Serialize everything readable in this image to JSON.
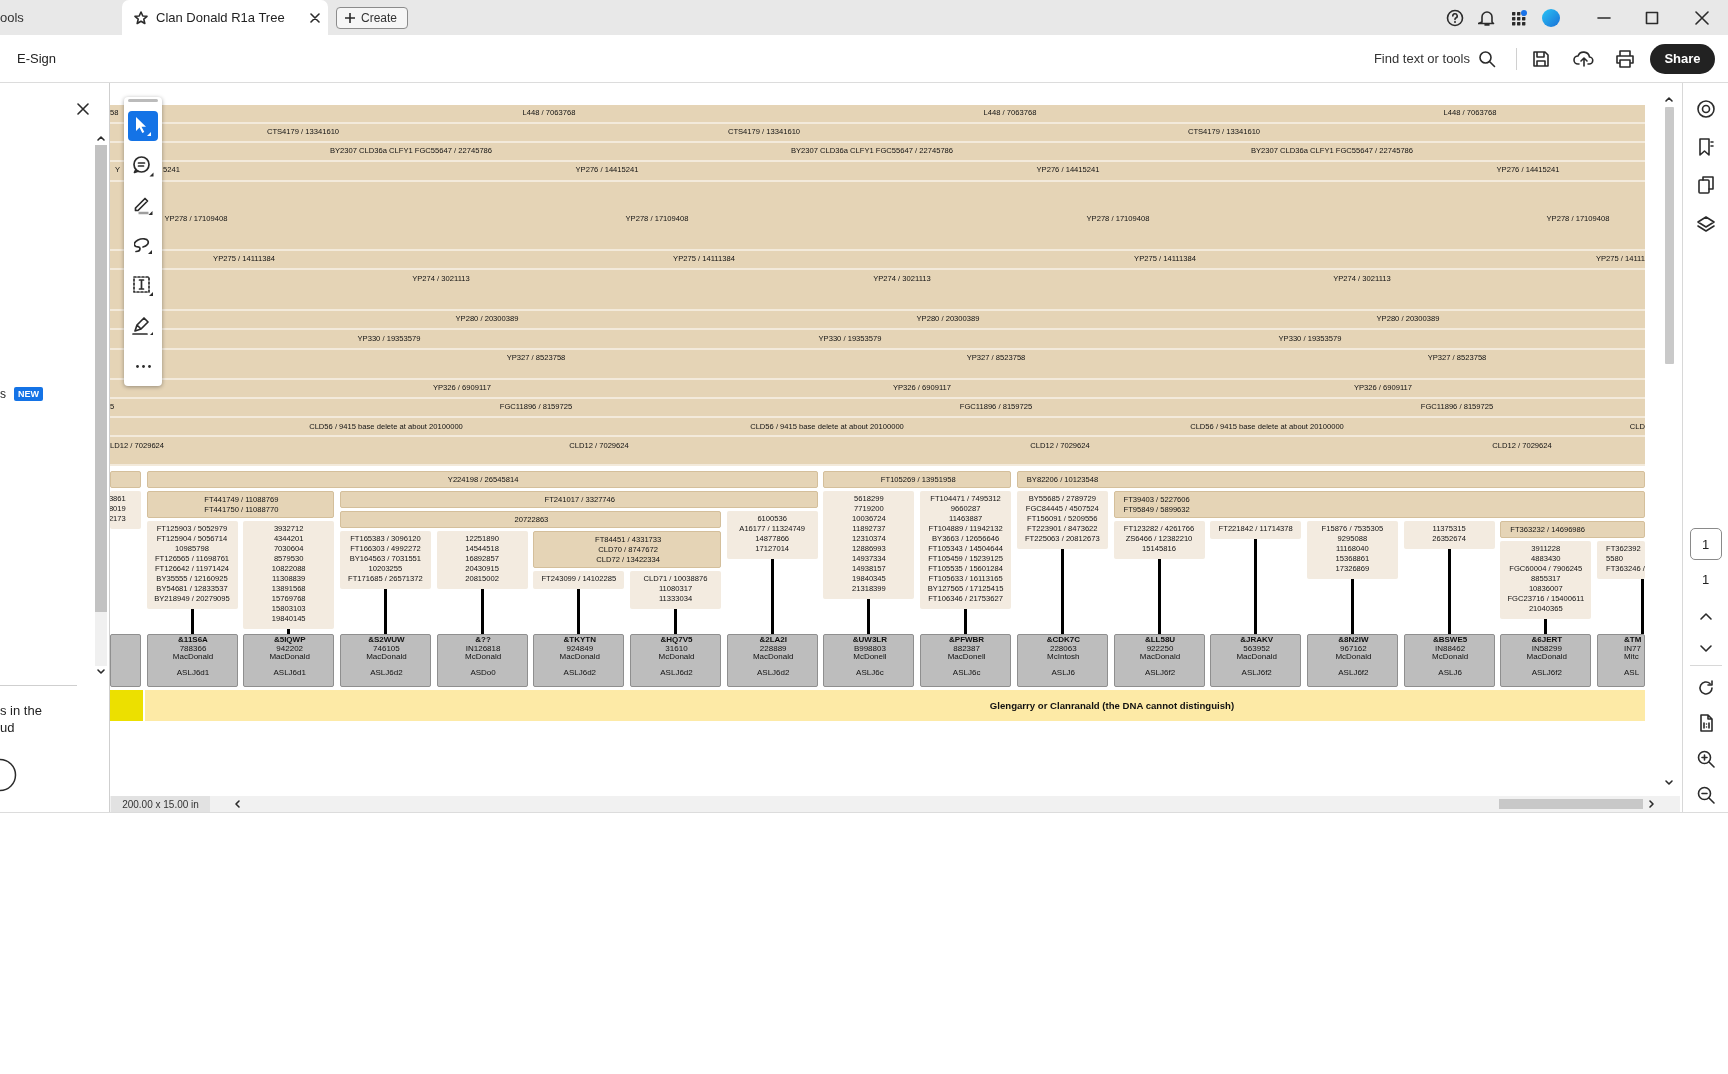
{
  "tabs": [
    {
      "label": "ools",
      "selected": false
    },
    {
      "label": "Clan Donald R1a Tree",
      "selected": true
    }
  ],
  "create_button": {
    "label": "Create"
  },
  "toolbar": {
    "menu": "E-Sign",
    "find": "Find text or tools",
    "share": "Share"
  },
  "left_panel": {
    "item": "s",
    "badge": "NEW",
    "note_lines": [
      "s in the",
      "ud"
    ]
  },
  "tools": [
    {
      "kind": "select",
      "selected": true
    },
    {
      "kind": "comment",
      "selected": false
    },
    {
      "kind": "highlight",
      "selected": false
    },
    {
      "kind": "draw",
      "selected": false
    },
    {
      "kind": "text-select",
      "selected": false
    },
    {
      "kind": "sign",
      "selected": false
    },
    {
      "kind": "more",
      "selected": false
    }
  ],
  "tree": {
    "bands": [
      {
        "labels": [
          "58",
          "L448 / 7063768",
          "L448 / 7063768",
          "L448 / 7063768"
        ]
      },
      {
        "labels": [
          "CTS4179 / 13341610",
          "CTS4179 / 13341610",
          "CTS4179 / 13341610"
        ]
      },
      {
        "labels": [
          "BY2307 CLD36a CLFY1 FGC55647 / 22745786",
          "BY2307 CLD36a CLFY1 FGC55647 / 22745786",
          "BY2307 CLD36a CLFY1 FGC55647 / 22745786"
        ]
      },
      {
        "labels": [
          "Y",
          "5241",
          "YP276 / 14415241",
          "YP276 / 14415241",
          "YP276 / 14415241"
        ]
      },
      {
        "labels": [
          "YP278 / 17109408",
          "YP278 / 17109408",
          "YP278 / 17109408",
          "YP278 / 17109408"
        ]
      },
      {
        "labels": [
          "YP275 / 14111384",
          "YP275 / 14111384",
          "YP275 / 14111384",
          "YP275 / 14111"
        ]
      },
      {
        "labels": [
          "YP274 / 3021113",
          "YP274 / 3021113",
          "YP274 / 3021113"
        ]
      },
      {
        "labels": [
          "YP280 / 20300389",
          "YP280 / 20300389",
          "YP280 / 20300389"
        ]
      },
      {
        "labels": [
          "YP330 / 19353579",
          "YP330 / 19353579",
          "YP330 / 19353579"
        ]
      },
      {
        "labels": [
          "YP327 / 8523758",
          "YP327 / 8523758",
          "YP327 / 8523758"
        ]
      },
      {
        "labels": [
          "YP326 / 6909117",
          "YP326 / 6909117",
          "YP326 / 6909117"
        ]
      },
      {
        "labels": [
          "5",
          "FGC11896 / 8159725",
          "FGC11896 / 8159725",
          "FGC11896 / 8159725"
        ]
      },
      {
        "labels": [
          "CLD56 / 9415 base delete at about 20100000",
          "CLD56 / 9415 base delete at about 20100000",
          "CLD56 / 9415 base delete at about 20100000",
          "CLD"
        ]
      },
      {
        "labels": [
          "LD12 / 7029624",
          "CLD12 / 7029624",
          "CLD12 / 7029624",
          "CLD12 / 7029624"
        ]
      }
    ],
    "branches": [
      {
        "kind": "branch",
        "children": [
          {
            "kind": "leaf",
            "snps": [
              "3861",
              "8019",
              "2173"
            ]
          }
        ]
      },
      {
        "kind": "branch",
        "snps": [
          "Y224198 / 26545814"
        ],
        "children": [
          {
            "kind": "branch",
            "snps": [
              "FT441749 / 11088769",
              "FT441750 / 11088770"
            ],
            "children": [
              {
                "kind": "leaf",
                "snps": [
                  "FT125903 / 5052979",
                  "FT125904 / 5056714",
                  "10985798",
                  "FT126565 / 11698761",
                  "FT126642 / 11971424",
                  "BY35555 / 12160925",
                  "BY54681 / 12833537",
                  "BY218949 / 20279095"
                ],
                "kit": {
                  "id": "&11S6A",
                  "number": "788366",
                  "surname": "MacDonald",
                  "haplogroup": "ASLJ6d1"
                }
              },
              {
                "kind": "leaf",
                "snps": [
                  "3932712",
                  "4344201",
                  "7030604",
                  "8579530",
                  "10822088",
                  "11308839",
                  "13891568",
                  "15769768",
                  "15803103",
                  "19840145"
                ],
                "kit": {
                  "id": "&5IQWP",
                  "number": "942202",
                  "surname": "MacDonald",
                  "haplogroup": "ASLJ6d1"
                }
              }
            ]
          },
          {
            "kind": "branch",
            "snps": [
              "FT241017 / 3327746"
            ],
            "children": [
              {
                "kind": "branch",
                "snps": [
                  "20722863"
                ],
                "children": [
                  {
                    "kind": "leaf",
                    "snps": [
                      "FT165383 / 3096120",
                      "FT166303 / 4992272",
                      "BY164563 / 7031551",
                      "10203255",
                      "FT171685 / 26571372"
                    ],
                    "kit": {
                      "id": "&S2WUW",
                      "number": "746105",
                      "surname": "MacDonald",
                      "haplogroup": "ASLJ6d2"
                    }
                  },
                  {
                    "kind": "leaf",
                    "snps": [
                      "12251890",
                      "14544518",
                      "16892857",
                      "20430915",
                      "20815002"
                    ],
                    "kit": {
                      "id": "&??",
                      "number": "IN126818",
                      "surname": "McDonald",
                      "haplogroup": "ASDo0"
                    }
                  },
                  {
                    "kind": "branch",
                    "snps": [
                      "FT84451 / 4331733",
                      "CLD70 / 8747672",
                      "CLD72 / 13422334"
                    ],
                    "children": [
                      {
                        "kind": "leaf",
                        "snps": [
                          "FT243099 / 14102285"
                        ],
                        "kit": {
                          "id": "&TKYTN",
                          "number": "924849",
                          "surname": "MacDonald",
                          "haplogroup": "ASLJ6d2"
                        }
                      },
                      {
                        "kind": "leaf",
                        "snps": [
                          "CLD71 / 10038876",
                          "11080317",
                          "11333034"
                        ],
                        "kit": {
                          "id": "&HQ7V5",
                          "number": "31610",
                          "surname": "McDonald",
                          "haplogroup": "ASLJ6d2"
                        }
                      }
                    ]
                  }
                ]
              },
              {
                "kind": "leaf",
                "snps": [
                  "6100536",
                  "A16177 / 11324749",
                  "14877866",
                  "17127014"
                ],
                "kit": {
                  "id": "&2LA2I",
                  "number": "228889",
                  "surname": "MacDonald",
                  "haplogroup": "ASLJ6d2"
                }
              }
            ]
          }
        ]
      },
      {
        "kind": "branch",
        "snps": [
          "FT105269 / 13951958"
        ],
        "children": [
          {
            "kind": "leaf",
            "snps": [
              "5618299",
              "7719200",
              "10036724",
              "11892737",
              "12310374",
              "12886993",
              "14937334",
              "14938157",
              "19840345",
              "21318399"
            ],
            "kit": {
              "id": "&UW3LR",
              "number": "B998803",
              "surname": "McDonell",
              "haplogroup": "ASLJ6c"
            }
          },
          {
            "kind": "leaf",
            "snps": [
              "FT104471 / 7495312",
              "9660287",
              "11463887",
              "FT104889 / 11942132",
              "BY3663 / 12656646",
              "FT105343 / 14504644",
              "FT105459 / 15239125",
              "FT105535 / 15601284",
              "FT105633 / 16113165",
              "BY127565 / 17125415",
              "FT106346 / 21753627"
            ],
            "kit": {
              "id": "&PFWBR",
              "number": "882387",
              "surname": "MacDonell",
              "haplogroup": "ASLJ6c"
            }
          }
        ]
      },
      {
        "kind": "branch",
        "snps": [
          "BY82206 / 10123548"
        ],
        "children": [
          {
            "kind": "leaf",
            "snps": [
              "BY55685 / 2789729",
              "FGC84445 / 4507524",
              "FT156091 / 5209556",
              "FT223901 / 8473622",
              "FT225063 / 20812673"
            ],
            "kit": {
              "id": "&CDK7C",
              "number": "228063",
              "surname": "McIntosh",
              "haplogroup": "ASLJ6"
            }
          },
          {
            "kind": "branch",
            "snps": [
              "FT39403 / 5227606",
              "FT95849 / 5899632"
            ],
            "children": [
              {
                "kind": "leaf",
                "snps": [
                  "FT123282 / 4261766",
                  "ZS6466 / 12382210",
                  "15145816"
                ],
                "kit": {
                  "id": "&LL58U",
                  "number": "922250",
                  "surname": "MacDonald",
                  "haplogroup": "ASLJ6f2"
                }
              },
              {
                "kind": "leaf",
                "snps": [
                  "FT221842 / 11714378"
                ],
                "kit": {
                  "id": "&JRAKV",
                  "number": "563952",
                  "surname": "MacDonald",
                  "haplogroup": "ASLJ6f2"
                }
              },
              {
                "kind": "leaf",
                "snps": [
                  "F15876 / 7535305",
                  "9295088",
                  "11168040",
                  "15368861",
                  "17326869"
                ],
                "kit": {
                  "id": "&8N2IW",
                  "number": "967162",
                  "surname": "McDonald",
                  "haplogroup": "ASLJ6f2"
                }
              },
              {
                "kind": "leaf",
                "snps": [
                  "11375315",
                  "26352674"
                ],
                "kit": {
                  "id": "&BSWE5",
                  "number": "IN88462",
                  "surname": "McDonald",
                  "haplogroup": "ASLJ6"
                }
              },
              {
                "kind": "branch",
                "snps": [
                  "FT363232 / 14696986"
                ],
                "children": [
                  {
                    "kind": "leaf",
                    "snps": [
                      "3911228",
                      "4883430",
                      "FGC60004 / 7906245",
                      "8855317",
                      "10836007",
                      "FGC23716 / 15400611",
                      "21040365"
                    ],
                    "kit": {
                      "id": "&6JERT",
                      "number": "IN58299",
                      "surname": "MacDonald",
                      "haplogroup": "ASLJ6f2"
                    }
                  },
                  {
                    "kind": "leaf",
                    "snps": [
                      "FT362392",
                      "5580",
                      "FT363246 /"
                    ],
                    "kit": {
                      "id": "&TM",
                      "number": "IN77",
                      "surname": "Mitc",
                      "haplogroup": "ASL"
                    }
                  }
                ]
              }
            ]
          }
        ]
      }
    ],
    "region": {
      "label": "Glengarry or Clanranald (the DNA cannot distinguish)"
    }
  },
  "status_bar": {
    "page_size": "200.00 x 15.00 in"
  },
  "page_nav": {
    "current": "1",
    "total": "1"
  }
}
